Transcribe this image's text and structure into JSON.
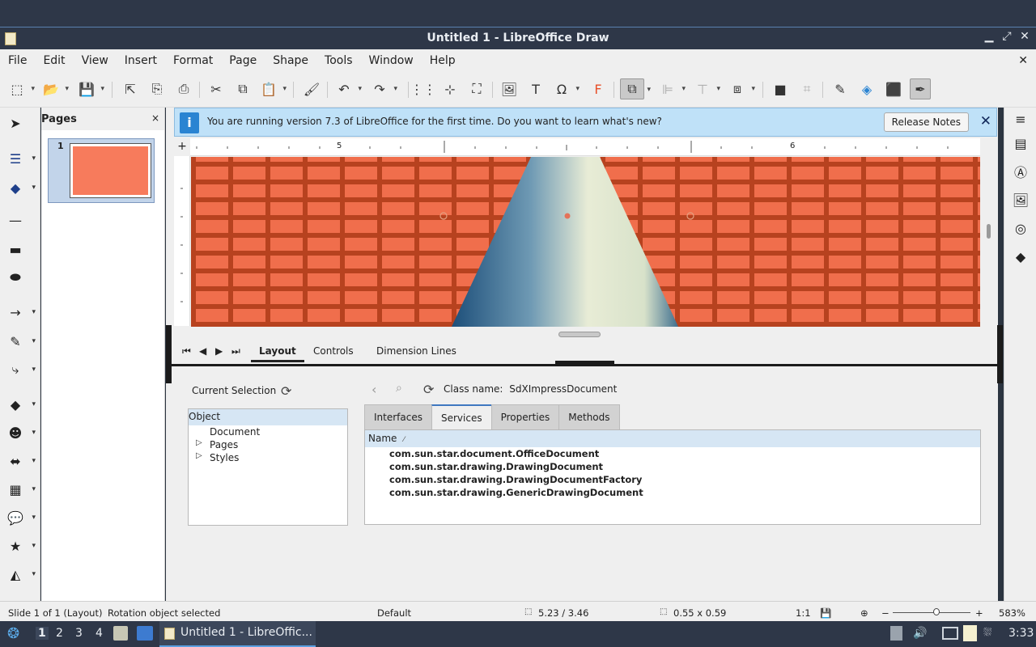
{
  "window": {
    "title": "Untitled 1 - LibreOffice Draw",
    "controls": [
      "▁",
      "⤢",
      "✕"
    ]
  },
  "menu": [
    "File",
    "Edit",
    "View",
    "Insert",
    "Format",
    "Page",
    "Shape",
    "Tools",
    "Window",
    "Help"
  ],
  "toolbar_icons": [
    "select-icon",
    "open-icon",
    "save-icon",
    "export-icon",
    "export-pdf-icon",
    "print-icon",
    "cut-icon",
    "copy-icon",
    "paste-icon",
    "clone-formatting-icon",
    "undo-icon",
    "redo-icon",
    "grid-icon",
    "helplines-icon",
    "zoom-page-icon",
    "insert-image-icon",
    "insert-textbox-icon",
    "special-character-icon",
    "fontwork-icon",
    "transformations-icon",
    "align-icon",
    "arrange-icon",
    "distribute-icon",
    "shadow-icon",
    "crop-icon",
    "points-icon",
    "glue-icon",
    "toggle-extrusion-icon",
    "draw-functions-icon"
  ],
  "pages_panel": {
    "title": "Pages",
    "close": "×",
    "page_number": "1"
  },
  "infobar": {
    "message": "You are running version 7.3 of LibreOffice for the first time. Do you want to learn what's new?",
    "button": "Release Notes",
    "close": "✕"
  },
  "ruler": {
    "labels": [
      "5",
      "6"
    ]
  },
  "view_tabs": {
    "active": "Layout",
    "items": [
      "Layout",
      "Controls",
      "Dimension Lines"
    ]
  },
  "inspector": {
    "current_selection": "Current Selection",
    "tree_header": "Object",
    "tree_items": [
      {
        "label": "Document",
        "expandable": false
      },
      {
        "label": "Pages",
        "expandable": true
      },
      {
        "label": "Styles",
        "expandable": true
      }
    ],
    "class_name_label": "Class name:",
    "class_name_value": "SdXImpressDocument",
    "tabs": [
      "Interfaces",
      "Services",
      "Properties",
      "Methods"
    ],
    "active_tab": "Services",
    "column_header": "Name",
    "services": [
      "com.sun.star.document.OfficeDocument",
      "com.sun.star.drawing.DrawingDocument",
      "com.sun.star.drawing.DrawingDocumentFactory",
      "com.sun.star.drawing.GenericDrawingDocument"
    ]
  },
  "status": {
    "slide": "Slide 1 of 1 (Layout)",
    "selection": "Rotation object selected",
    "style": "Default",
    "position": "5.23 / 3.46",
    "size": "0.55 x 0.59",
    "scale": "1:1",
    "zoom": "583%"
  },
  "taskbar": {
    "workspaces": [
      "1",
      "2",
      "3",
      "4"
    ],
    "active_workspace": "1",
    "app_label": "Untitled 1 - LibreOffic...",
    "clock": "3:33"
  },
  "colors": {
    "canvas_brick": "#f06e4c",
    "mortar": "#b7421f",
    "accent": "#3f78c0",
    "infobar_bg": "#bfe1f8"
  }
}
